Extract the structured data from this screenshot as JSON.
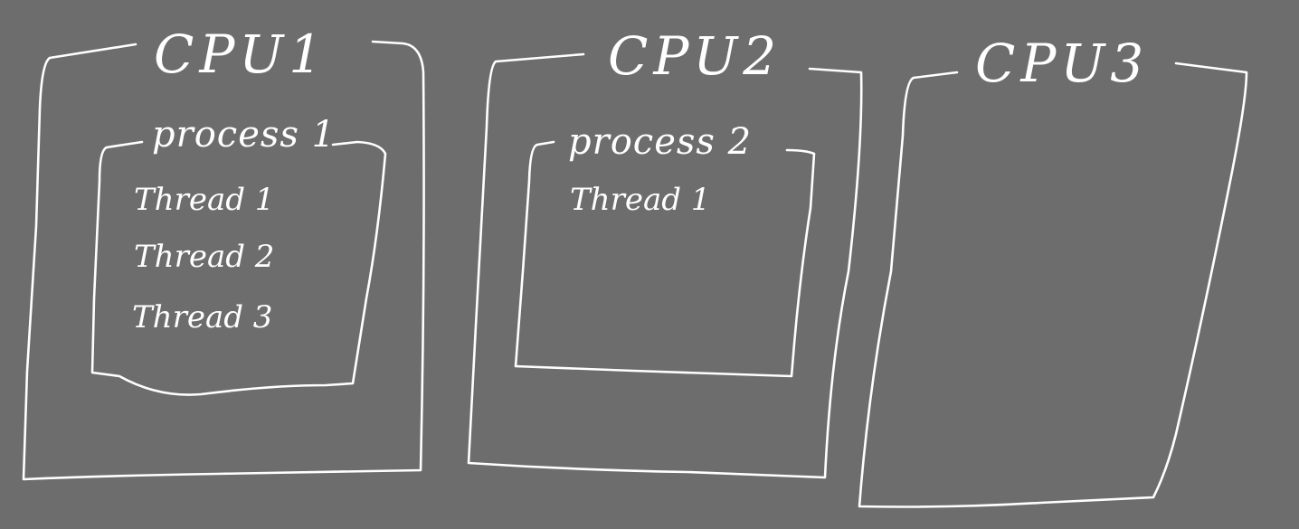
{
  "cpus": [
    {
      "title": "CPU1",
      "process": {
        "label": "process 1",
        "threads": [
          "Thread 1",
          "Thread 2",
          "Thread 3"
        ]
      }
    },
    {
      "title": "CPU2",
      "process": {
        "label": "process 2",
        "threads": [
          "Thread 1"
        ]
      }
    },
    {
      "title": "CPU3"
    }
  ]
}
